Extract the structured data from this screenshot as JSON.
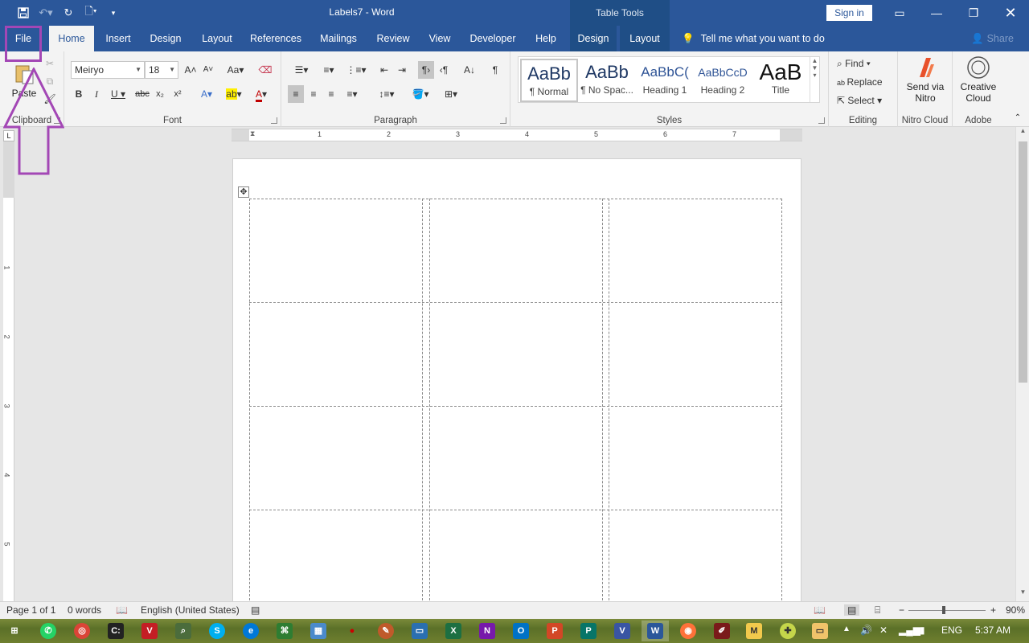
{
  "titlebar": {
    "doc_title": "Labels7  -  Word",
    "table_tools": "Table Tools",
    "sign_in": "Sign in",
    "colors": {
      "bg": "#2b579a",
      "context": "#1f4e86"
    }
  },
  "tabs": [
    {
      "label": "File"
    },
    {
      "label": "Home"
    },
    {
      "label": "Insert"
    },
    {
      "label": "Design"
    },
    {
      "label": "Layout"
    },
    {
      "label": "References"
    },
    {
      "label": "Mailings"
    },
    {
      "label": "Review"
    },
    {
      "label": "View"
    },
    {
      "label": "Developer"
    },
    {
      "label": "Help"
    },
    {
      "label": "Design"
    },
    {
      "label": "Layout"
    }
  ],
  "tell_me": "Tell me what you want to do",
  "share": "Share",
  "ribbon": {
    "clipboard": {
      "label": "Clipboard",
      "paste": "Paste"
    },
    "font": {
      "label": "Font",
      "name": "Meiryo",
      "size": "18"
    },
    "paragraph": {
      "label": "Paragraph"
    },
    "styles": {
      "label": "Styles",
      "items": [
        {
          "preview": "AaBb",
          "name": "¶ Normal"
        },
        {
          "preview": "AaBb",
          "name": "¶ No Spac..."
        },
        {
          "preview": "AaBbC(",
          "name": "Heading 1"
        },
        {
          "preview": "AaBbCcD",
          "name": "Heading 2"
        },
        {
          "preview": "AaB",
          "name": "Title"
        }
      ]
    },
    "editing": {
      "label": "Editing",
      "find": "Find",
      "replace": "Replace",
      "select": "Select"
    },
    "nitro": {
      "label": "Nitro Cloud",
      "send1": "Send via",
      "send2": "Nitro"
    },
    "adobe": {
      "label": "Adobe",
      "cc1": "Creative",
      "cc2": "Cloud"
    }
  },
  "ruler": {
    "h_numbers": [
      "1",
      "2",
      "3",
      "4",
      "5",
      "6",
      "7"
    ],
    "v_numbers": [
      "1",
      "2",
      "3",
      "4",
      "5"
    ]
  },
  "status": {
    "page": "Page 1 of 1",
    "words": "0 words",
    "language": "English (United States)",
    "zoom": "90%"
  },
  "taskbar": {
    "lang": "ENG",
    "time": "5:37 AM"
  }
}
